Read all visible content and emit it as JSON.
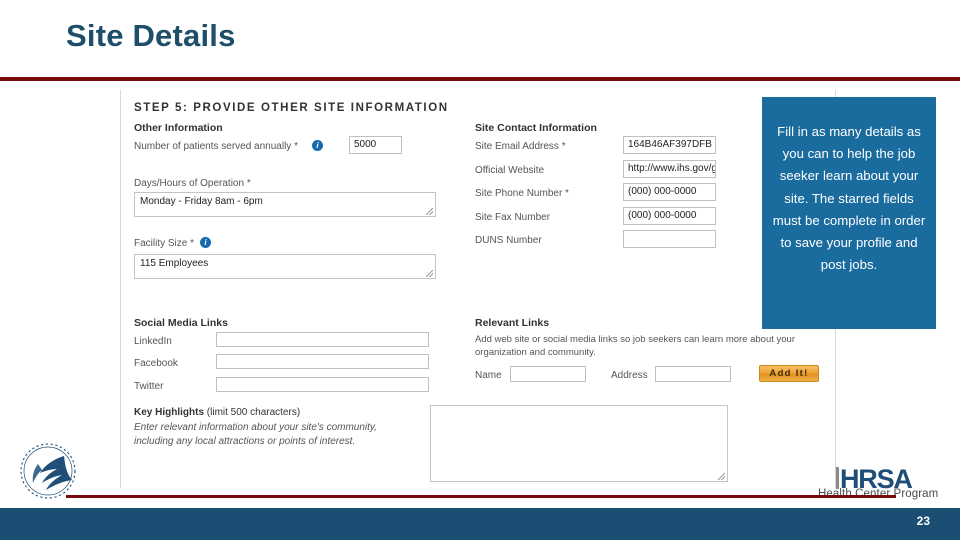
{
  "slide": {
    "title": "Site Details",
    "page_number": "23",
    "accent_red": "#7a0a0a",
    "accent_blue": "#1c4e74",
    "title_color": "#1f4e6b"
  },
  "form": {
    "step_heading": "STEP 5: PROVIDE OTHER SITE INFORMATION",
    "other_information": {
      "heading": "Other Information",
      "patients_label": "Number of patients served annually *",
      "patients_info_icon": "info-icon",
      "patients_value": "5000",
      "hours_label": "Days/Hours of Operation *",
      "hours_value": "Monday - Friday 8am - 6pm",
      "facility_label": "Facility Size *",
      "facility_info_icon": "info-icon",
      "facility_value": "115 Employees"
    },
    "site_contact": {
      "heading": "Site Contact Information",
      "email_label": "Site Email Address *",
      "email_value": "164B46AF397DFB",
      "website_label": "Official Website",
      "website_value": "http://www.ihs.gov/g",
      "phone_label": "Site Phone Number *",
      "phone_value": "(000) 000-0000",
      "fax_label": "Site Fax Number",
      "fax_value": "(000) 000-0000",
      "duns_label": "DUNS Number",
      "duns_value": ""
    },
    "social_media": {
      "heading": "Social Media Links",
      "linkedin_label": "LinkedIn",
      "linkedin_value": "",
      "facebook_label": "Facebook",
      "facebook_value": "",
      "twitter_label": "Twitter",
      "twitter_value": ""
    },
    "relevant_links": {
      "heading": "Relevant Links",
      "description": "Add web site or social media links so job seekers can learn more about your organization and community.",
      "name_label": "Name",
      "name_value": "",
      "address_label": "Address",
      "address_value": "",
      "add_button": "Add It!"
    },
    "key_highlights": {
      "title": "Key Highlights",
      "limit": "(limit 500 characters)",
      "instructions": "Enter relevant information about your site's community, including any local attractions or points of interest.",
      "value": ""
    }
  },
  "callout": {
    "text": "Fill in as many details as you can to help the job seeker learn about your site. The starred fields must be complete in order to save your profile and post jobs.",
    "background": "#1a6b9e"
  },
  "branding": {
    "hrsa_word": "HRSA",
    "hrsa_tagline": "Health Center Program",
    "hhs_seal_alt": "hhs-seal"
  }
}
